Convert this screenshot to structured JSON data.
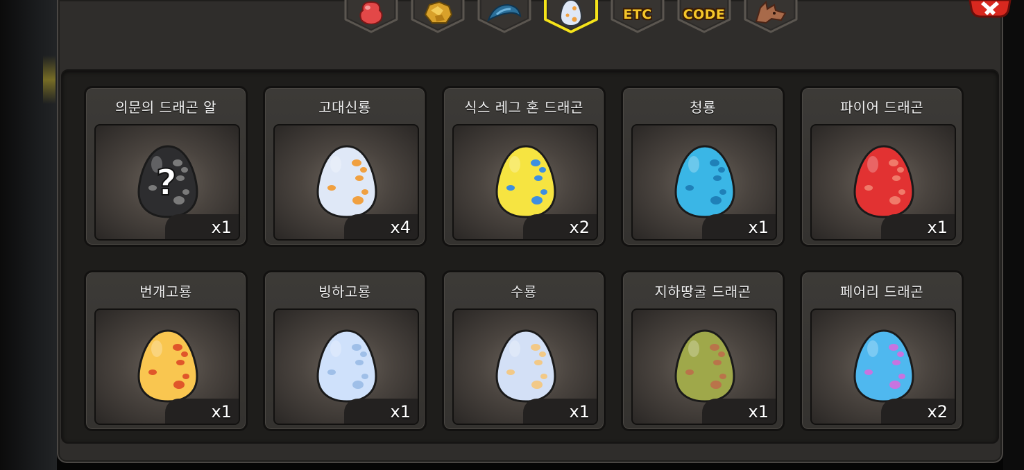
{
  "tabs": [
    {
      "name": "red-item",
      "label": "",
      "icon": "red-potion-icon"
    },
    {
      "name": "gold-item",
      "label": "",
      "icon": "gold-ore-icon"
    },
    {
      "name": "blue-item",
      "label": "",
      "icon": "blue-scale-icon"
    },
    {
      "name": "egg",
      "label": "",
      "icon": "egg-icon",
      "selected": true
    },
    {
      "name": "etc",
      "label": "ETC",
      "icon": ""
    },
    {
      "name": "code",
      "label": "CODE",
      "icon": ""
    },
    {
      "name": "dragon",
      "label": "",
      "icon": "dragon-head-icon"
    }
  ],
  "eggs": [
    {
      "name": "의문의 드래곤 알",
      "qty": "x1",
      "egg_color": "#2d2d2f",
      "spot_color": "#7a7a7a",
      "question": "?"
    },
    {
      "name": "고대신룡",
      "qty": "x4",
      "egg_color": "#dfe8f7",
      "spot_color": "#f0a040"
    },
    {
      "name": "식스 레그 혼 드래곤",
      "qty": "x2",
      "egg_color": "#f6e441",
      "spot_color": "#3d8fe0"
    },
    {
      "name": "청룡",
      "qty": "x1",
      "egg_color": "#3ab6e6",
      "spot_color": "#1f80b8"
    },
    {
      "name": "파이어 드래곤",
      "qty": "x1",
      "egg_color": "#e23232",
      "spot_color": "#f07a6a"
    },
    {
      "name": "번개고룡",
      "qty": "x1",
      "egg_color": "#f9c650",
      "spot_color": "#e0562a"
    },
    {
      "name": "빙하고룡",
      "qty": "x1",
      "egg_color": "#cfe1fb",
      "spot_color": "#9fbfe8"
    },
    {
      "name": "수룡",
      "qty": "x1",
      "egg_color": "#d3e0f6",
      "spot_color": "#f2c987"
    },
    {
      "name": "지하땅굴 드래곤",
      "qty": "x1",
      "egg_color": "#9fa84a",
      "spot_color": "#b9744a"
    },
    {
      "name": "페어리 드래곤",
      "qty": "x2",
      "egg_color": "#4fb8ef",
      "spot_color": "#c774e0"
    }
  ]
}
